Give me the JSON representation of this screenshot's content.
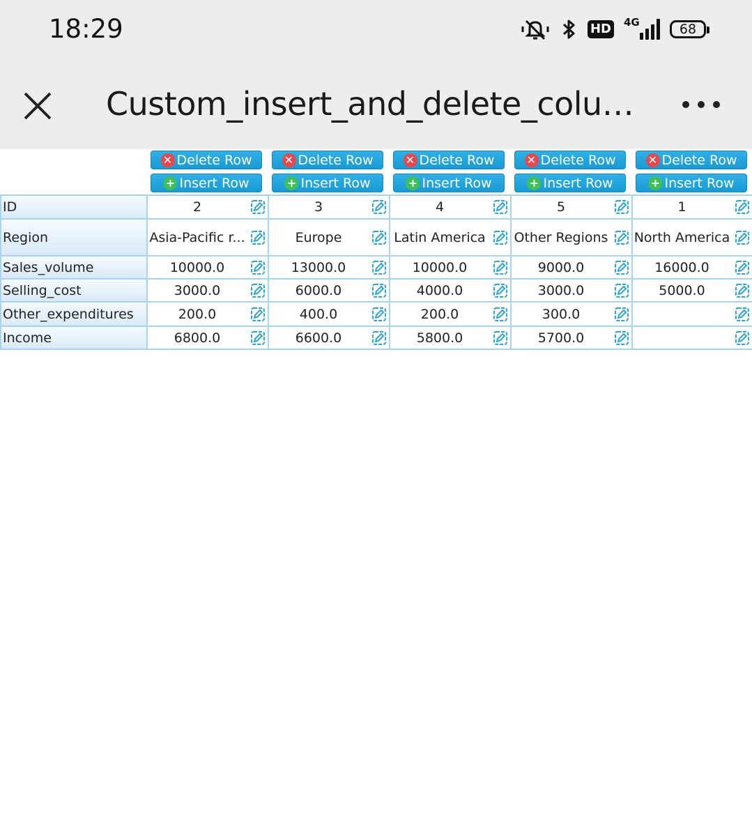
{
  "status": {
    "time": "18:29",
    "battery": "68",
    "hd": "HD",
    "network": "4G"
  },
  "titlebar": {
    "title": "Custom_insert_and_delete_column_..."
  },
  "actions": {
    "delete_label": "Delete Row",
    "insert_label": "Insert Row"
  },
  "table": {
    "row_headers": [
      "ID",
      "Region",
      "Sales_volume",
      "Selling_cost",
      "Other_expenditures",
      "Income"
    ],
    "columns": [
      {
        "id": "2",
        "region": "Asia-Pacific r...",
        "sales": "10000.0",
        "cost": "3000.0",
        "other": "200.0",
        "income": "6800.0"
      },
      {
        "id": "3",
        "region": "Europe",
        "sales": "13000.0",
        "cost": "6000.0",
        "other": "400.0",
        "income": "6600.0"
      },
      {
        "id": "4",
        "region": "Latin America",
        "sales": "10000.0",
        "cost": "4000.0",
        "other": "200.0",
        "income": "5800.0"
      },
      {
        "id": "5",
        "region": "Other Regions",
        "sales": "9000.0",
        "cost": "3000.0",
        "other": "300.0",
        "income": "5700.0"
      },
      {
        "id": "1",
        "region": "North America",
        "sales": "16000.0",
        "cost": "5000.0",
        "other": "",
        "income": ""
      }
    ]
  },
  "colors": {
    "accent": "#1a9ad4",
    "delete": "#e8474d",
    "insert": "#3fbf5a",
    "border": "#a9d3f2"
  }
}
